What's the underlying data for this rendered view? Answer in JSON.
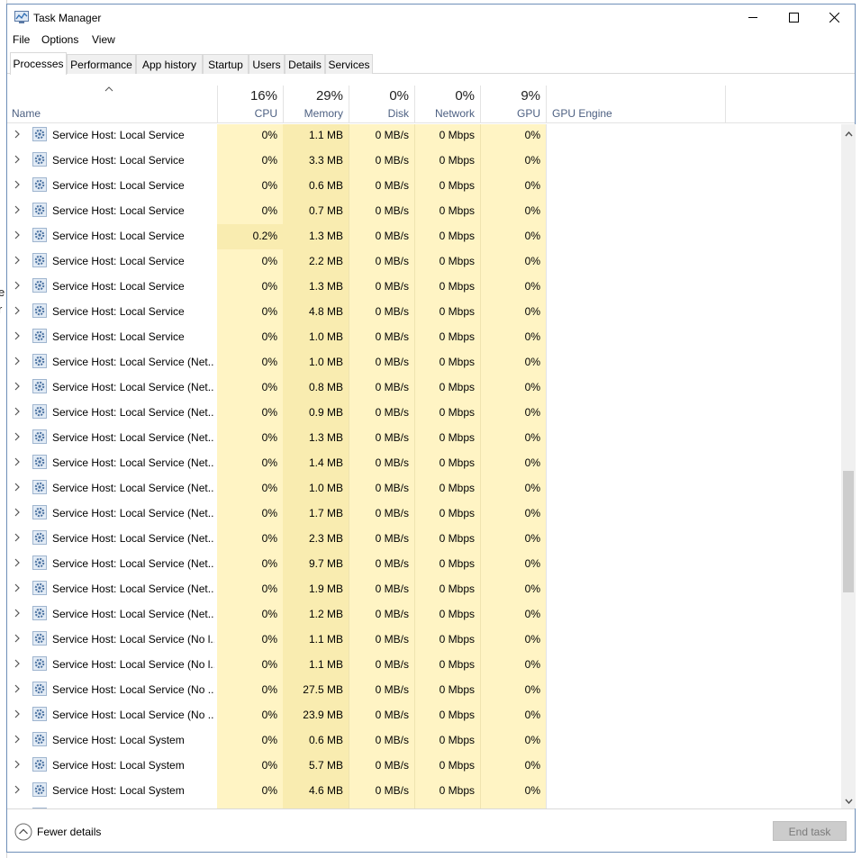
{
  "window": {
    "title": "Task Manager"
  },
  "menu": [
    "File",
    "Options",
    "View"
  ],
  "tabs": [
    "Processes",
    "Performance",
    "App history",
    "Startup",
    "Users",
    "Details",
    "Services"
  ],
  "columns": {
    "name": "Name",
    "cpu": {
      "pct": "16%",
      "label": "CPU"
    },
    "memory": {
      "pct": "29%",
      "label": "Memory"
    },
    "disk": {
      "pct": "0%",
      "label": "Disk"
    },
    "network": {
      "pct": "0%",
      "label": "Network"
    },
    "gpu": {
      "pct": "9%",
      "label": "GPU"
    },
    "gpu_engine": "GPU Engine"
  },
  "rows": [
    {
      "name": "Service Host: Local Service",
      "cpu": "0%",
      "mem": "1.1 MB",
      "disk": "0 MB/s",
      "net": "0 Mbps",
      "gpu": "0%"
    },
    {
      "name": "Service Host: Local Service",
      "cpu": "0%",
      "mem": "3.3 MB",
      "disk": "0 MB/s",
      "net": "0 Mbps",
      "gpu": "0%"
    },
    {
      "name": "Service Host: Local Service",
      "cpu": "0%",
      "mem": "0.6 MB",
      "disk": "0 MB/s",
      "net": "0 Mbps",
      "gpu": "0%"
    },
    {
      "name": "Service Host: Local Service",
      "cpu": "0%",
      "mem": "0.7 MB",
      "disk": "0 MB/s",
      "net": "0 Mbps",
      "gpu": "0%"
    },
    {
      "name": "Service Host: Local Service",
      "cpu": "0.2%",
      "mem": "1.3 MB",
      "disk": "0 MB/s",
      "net": "0 Mbps",
      "gpu": "0%"
    },
    {
      "name": "Service Host: Local Service",
      "cpu": "0%",
      "mem": "2.2 MB",
      "disk": "0 MB/s",
      "net": "0 Mbps",
      "gpu": "0%"
    },
    {
      "name": "Service Host: Local Service",
      "cpu": "0%",
      "mem": "1.3 MB",
      "disk": "0 MB/s",
      "net": "0 Mbps",
      "gpu": "0%"
    },
    {
      "name": "Service Host: Local Service",
      "cpu": "0%",
      "mem": "4.8 MB",
      "disk": "0 MB/s",
      "net": "0 Mbps",
      "gpu": "0%"
    },
    {
      "name": "Service Host: Local Service",
      "cpu": "0%",
      "mem": "1.0 MB",
      "disk": "0 MB/s",
      "net": "0 Mbps",
      "gpu": "0%"
    },
    {
      "name": "Service Host: Local Service (Net...",
      "cpu": "0%",
      "mem": "1.0 MB",
      "disk": "0 MB/s",
      "net": "0 Mbps",
      "gpu": "0%"
    },
    {
      "name": "Service Host: Local Service (Net...",
      "cpu": "0%",
      "mem": "0.8 MB",
      "disk": "0 MB/s",
      "net": "0 Mbps",
      "gpu": "0%"
    },
    {
      "name": "Service Host: Local Service (Net...",
      "cpu": "0%",
      "mem": "0.9 MB",
      "disk": "0 MB/s",
      "net": "0 Mbps",
      "gpu": "0%"
    },
    {
      "name": "Service Host: Local Service (Net...",
      "cpu": "0%",
      "mem": "1.3 MB",
      "disk": "0 MB/s",
      "net": "0 Mbps",
      "gpu": "0%"
    },
    {
      "name": "Service Host: Local Service (Net...",
      "cpu": "0%",
      "mem": "1.4 MB",
      "disk": "0 MB/s",
      "net": "0 Mbps",
      "gpu": "0%"
    },
    {
      "name": "Service Host: Local Service (Net...",
      "cpu": "0%",
      "mem": "1.0 MB",
      "disk": "0 MB/s",
      "net": "0 Mbps",
      "gpu": "0%"
    },
    {
      "name": "Service Host: Local Service (Net...",
      "cpu": "0%",
      "mem": "1.7 MB",
      "disk": "0 MB/s",
      "net": "0 Mbps",
      "gpu": "0%"
    },
    {
      "name": "Service Host: Local Service (Net...",
      "cpu": "0%",
      "mem": "2.3 MB",
      "disk": "0 MB/s",
      "net": "0 Mbps",
      "gpu": "0%"
    },
    {
      "name": "Service Host: Local Service (Net...",
      "cpu": "0%",
      "mem": "9.7 MB",
      "disk": "0 MB/s",
      "net": "0 Mbps",
      "gpu": "0%"
    },
    {
      "name": "Service Host: Local Service (Net...",
      "cpu": "0%",
      "mem": "1.9 MB",
      "disk": "0 MB/s",
      "net": "0 Mbps",
      "gpu": "0%"
    },
    {
      "name": "Service Host: Local Service (Net...",
      "cpu": "0%",
      "mem": "1.2 MB",
      "disk": "0 MB/s",
      "net": "0 Mbps",
      "gpu": "0%"
    },
    {
      "name": "Service Host: Local Service (No l...",
      "cpu": "0%",
      "mem": "1.1 MB",
      "disk": "0 MB/s",
      "net": "0 Mbps",
      "gpu": "0%"
    },
    {
      "name": "Service Host: Local Service (No l...",
      "cpu": "0%",
      "mem": "1.1 MB",
      "disk": "0 MB/s",
      "net": "0 Mbps",
      "gpu": "0%"
    },
    {
      "name": "Service Host: Local Service (No ...",
      "cpu": "0%",
      "mem": "27.5 MB",
      "disk": "0 MB/s",
      "net": "0 Mbps",
      "gpu": "0%"
    },
    {
      "name": "Service Host: Local Service (No ...",
      "cpu": "0%",
      "mem": "23.9 MB",
      "disk": "0 MB/s",
      "net": "0 Mbps",
      "gpu": "0%"
    },
    {
      "name": "Service Host: Local System",
      "cpu": "0%",
      "mem": "0.6 MB",
      "disk": "0 MB/s",
      "net": "0 Mbps",
      "gpu": "0%"
    },
    {
      "name": "Service Host: Local System",
      "cpu": "0%",
      "mem": "5.7 MB",
      "disk": "0 MB/s",
      "net": "0 Mbps",
      "gpu": "0%"
    },
    {
      "name": "Service Host: Local System",
      "cpu": "0%",
      "mem": "4.6 MB",
      "disk": "0 MB/s",
      "net": "0 Mbps",
      "gpu": "0%"
    }
  ],
  "footer": {
    "fewer_details": "Fewer details",
    "end_task": "End task"
  },
  "colors": {
    "heat_light": "#fff4c4",
    "heat_medium": "#f9ecb0",
    "header_label": "#4d6082",
    "border": "#6f8fb8"
  }
}
